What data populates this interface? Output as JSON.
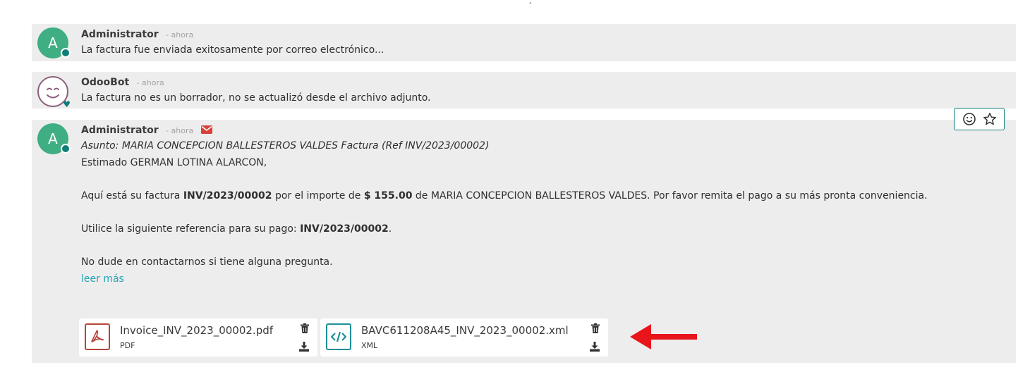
{
  "stray_mark": "´",
  "messages": [
    {
      "author": "Administrator",
      "avatar_letter": "A",
      "date": "- ahora",
      "body": "La factura fue enviada exitosamente por correo electrónico..."
    },
    {
      "author": "OdooBot",
      "date": "- ahora",
      "body": "La factura no es un borrador, no se actualizó desde el archivo adjunto."
    },
    {
      "author": "Administrator",
      "avatar_letter": "A",
      "date": "- ahora",
      "subject": "Asunto: MARIA CONCEPCION BALLESTEROS VALDES Factura (Ref INV/2023/00002)",
      "greeting": "Estimado GERMAN LOTINA ALARCON,",
      "p1_a": "Aquí está su factura ",
      "p1_invoice": "INV/2023/00002",
      "p1_b": " por el importe de ",
      "p1_amount": "$ 155.00",
      "p1_c": " de MARIA CONCEPCION BALLESTEROS VALDES. Por favor remita el pago a su más pronta conveniencia.",
      "p2_a": "Utilice la siguiente referencia para su pago: ",
      "p2_ref": "INV/2023/00002",
      "p2_b": ".",
      "p3": "No dude en contactarnos si tiene alguna pregunta.",
      "read_more": "leer más",
      "attachments": [
        {
          "name": "Invoice_INV_2023_00002.pdf",
          "type": "PDF",
          "icon": "pdf-file-icon"
        },
        {
          "name": "BAVC611208A45_INV_2023_00002.xml",
          "type": "XML",
          "icon": "code-file-icon"
        }
      ]
    }
  ],
  "colors": {
    "avatar": "#3fae82",
    "status": "#0f7d78",
    "link": "#27a3b3",
    "pdf": "#b8443a",
    "xml": "#1f8f97",
    "envelope": "#d9403a",
    "arrow": "#e8151b"
  }
}
